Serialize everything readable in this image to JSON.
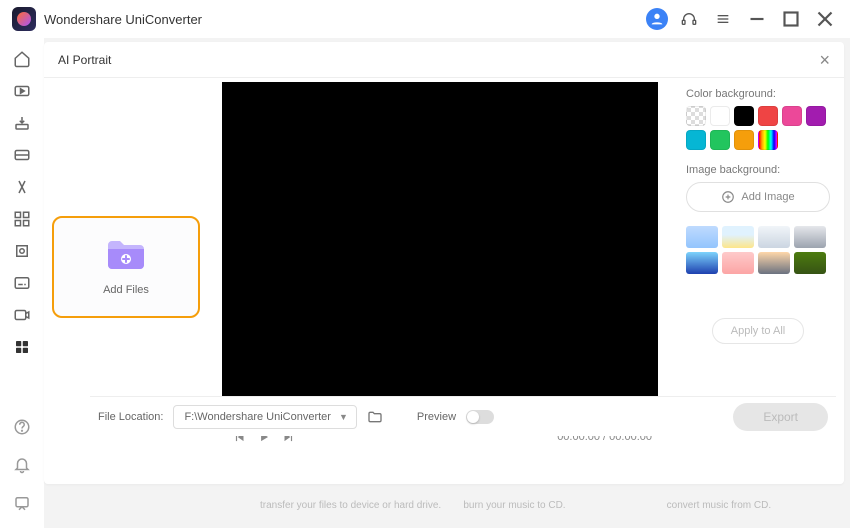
{
  "app": {
    "title": "Wondershare UniConverter"
  },
  "panel": {
    "title": "AI Portrait"
  },
  "add_files": {
    "label": "Add Files"
  },
  "playback": {
    "time": "00:00:00 / 00:00:00"
  },
  "right": {
    "color_label": "Color background:",
    "image_label": "Image background:",
    "add_image_label": "Add Image",
    "apply_label": "Apply to All",
    "colors": [
      "checker",
      "#ffffff",
      "#000000",
      "#ef4444",
      "#ec4899",
      "#a21caf",
      "#06b6d4",
      "#22c55e",
      "#f59e0b",
      "rainbow"
    ],
    "thumbs": [
      "linear-gradient(180deg,#bfdbfe,#93c5fd)",
      "linear-gradient(180deg,#e0f2fe 40%,#fde68a)",
      "linear-gradient(180deg,#f1f5f9,#cbd5e1)",
      "linear-gradient(180deg,#e5e7eb,#9ca3af)",
      "linear-gradient(180deg,#7dd3fc,#1e40af)",
      "linear-gradient(180deg,#fecaca,#fca5a5)",
      "linear-gradient(180deg,#fed7aa,#6b7280)",
      "linear-gradient(180deg,#4d7c0f,#365314)"
    ]
  },
  "footer": {
    "location_label": "File Location:",
    "location_value": "F:\\Wondershare UniConverter",
    "preview_label": "Preview",
    "export_label": "Export"
  },
  "lower": {
    "c1": "transfer your files to device or hard drive.",
    "c2": "burn your music to CD.",
    "c3": "convert music from CD."
  }
}
